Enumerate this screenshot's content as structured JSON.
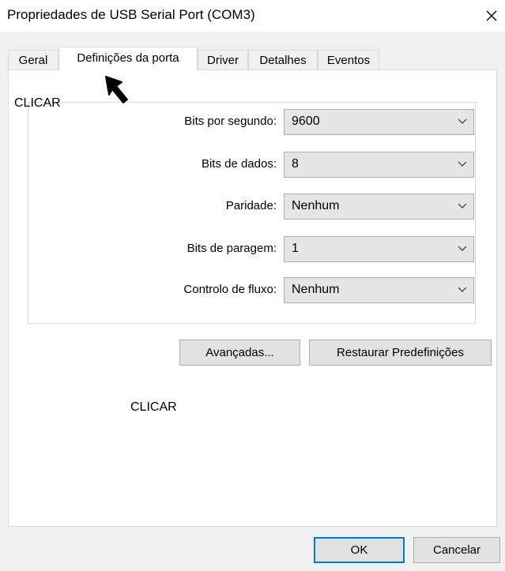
{
  "window": {
    "title": "Propriedades de USB Serial Port (COM3)"
  },
  "tabs": [
    {
      "label": "Geral",
      "active": false
    },
    {
      "label": "Definições da porta",
      "active": true
    },
    {
      "label": "Driver",
      "active": false
    },
    {
      "label": "Detalhes",
      "active": false
    },
    {
      "label": "Eventos",
      "active": false
    }
  ],
  "settings": [
    {
      "label": "Bits por segundo:",
      "value": "9600"
    },
    {
      "label": "Bits de dados:",
      "value": "8"
    },
    {
      "label": "Paridade:",
      "value": "Nenhum"
    },
    {
      "label": "Bits de paragem:",
      "value": "1"
    },
    {
      "label": "Controlo de fluxo:",
      "value": "Nenhum"
    }
  ],
  "buttons": {
    "advanced": "Avançadas...",
    "restore_defaults": "Restaurar Predefinições",
    "ok": "OK",
    "cancel": "Cancelar"
  },
  "annotations": {
    "top_click": "CLICAR",
    "middle_click": "CLICAR"
  },
  "icons": {
    "close": "close-icon",
    "dropdown": "chevron-down-icon",
    "cursor": "mouse-pointer-icon"
  },
  "colors": {
    "dialog_background": "#f0f0f0",
    "panel_background": "#ffffff",
    "control_background": "#e5e5e5",
    "default_button_border": "#0078d7"
  }
}
